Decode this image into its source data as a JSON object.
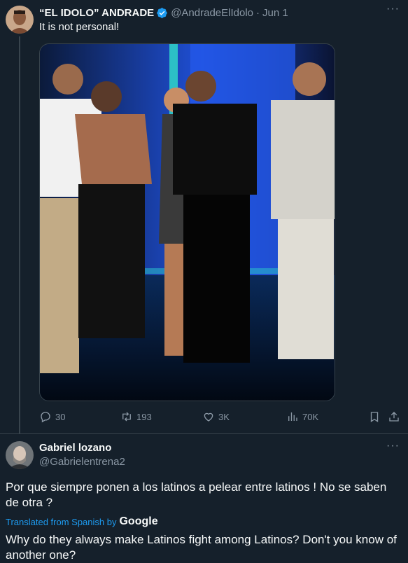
{
  "post": {
    "author_name": "“EL IDOLO” ANDRADE",
    "handle": "@AndradeElIdolo",
    "separator": "·",
    "date": "Jun 1",
    "more": "···",
    "text": "It is not personal!",
    "verified_color": "#1d9bf0",
    "actions": {
      "replies": "30",
      "reposts": "193",
      "likes": "3K",
      "views": "70K"
    }
  },
  "reply": {
    "author_name": "Gabriel lozano",
    "handle": "@Gabrielentrena2",
    "more": "···",
    "text": "Por que siempre ponen a los latinos a pelear entre latinos ! No se saben de otra ?",
    "translated_label": "Translated from Spanish by",
    "translated_by": "Google",
    "translation": "Why do they always make Latinos fight among Latinos? Don't you know of another one?"
  },
  "colors": {
    "background": "#15202b",
    "secondary_text": "#8b98a5",
    "link": "#1d9bf0",
    "divider": "#38444d"
  }
}
